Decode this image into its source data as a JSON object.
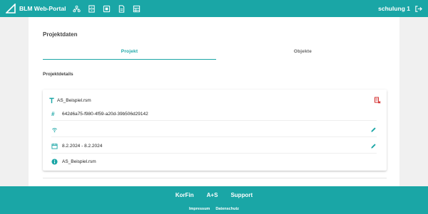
{
  "header": {
    "title": "BLM Web-Portal",
    "nav_icons": [
      "org-icon",
      "file-cabinet-icon",
      "box-icon",
      "document-icon",
      "table-icon"
    ],
    "user_label": "schulung 1"
  },
  "page": {
    "section_title": "Projektdaten",
    "tabs": [
      {
        "label": "Projekt",
        "active": true
      },
      {
        "label": "Objekte",
        "active": false
      }
    ],
    "subsection_title": "Projektdetails"
  },
  "card": {
    "name": "AS_Beispiel.rsm",
    "id": "642d6a75-f980-4f59-a20d-39b506d29142",
    "url": "",
    "date_range": "8.2.2024 - 8.2.2024",
    "info": "AS_Beispiel.rsm"
  },
  "footer": {
    "links": [
      "KorFin",
      "A+S",
      "Support"
    ],
    "sublinks": [
      "Impressum",
      "Datenschutz"
    ]
  },
  "colors": {
    "accent": "#1aa6a6",
    "delete": "#d32f2f"
  }
}
